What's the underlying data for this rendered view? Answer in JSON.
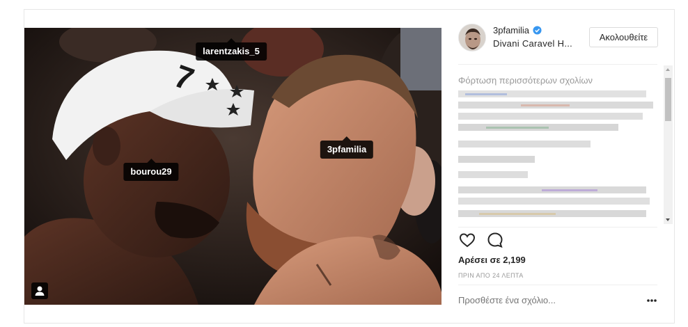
{
  "photo": {
    "tags": [
      {
        "label": "larentzakis_5"
      },
      {
        "label": "bourou29"
      },
      {
        "label": "3pfamilia"
      }
    ],
    "user_tag_icon": "person-icon"
  },
  "header": {
    "username": "3pfamilia",
    "verified_icon": "verified-badge-icon",
    "location": "Divani Caravel H...",
    "follow_label": "Ακολουθείτε"
  },
  "comments": {
    "load_more": "Φόρτωση περισσότερων σχολίων"
  },
  "actions": {
    "like_icon": "heart-icon",
    "comment_icon": "comment-bubble-icon"
  },
  "likes": "Αρέσει σε 2,199",
  "time": "ΠΡΙΝ ΑΠΟ 24 ΛΕΠΤΑ",
  "comment_box": {
    "placeholder": "Προσθέστε ένα σχόλιο..."
  },
  "more_icon": "ellipsis-icon",
  "colors": {
    "verified": "#3897f0",
    "tag_bg": "#000000",
    "border": "#e6e6e6",
    "muted_text": "#999999"
  }
}
